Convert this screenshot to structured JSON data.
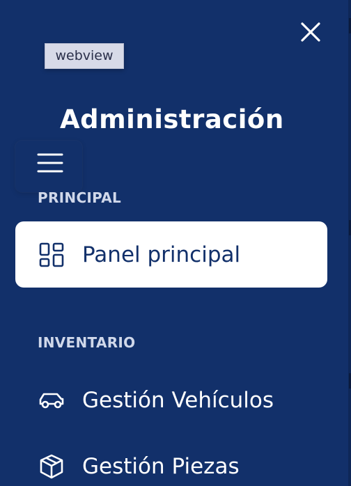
{
  "drawer": {
    "title": "Administración",
    "tooltip": "webview",
    "close_icon": "close-icon",
    "menu_icon": "hamburger-menu-icon"
  },
  "sections": [
    {
      "label": "PRINCIPAL",
      "items": [
        {
          "label": "Panel principal",
          "icon": "dashboard-grid-icon",
          "active": true
        }
      ]
    },
    {
      "label": "INVENTARIO",
      "items": [
        {
          "label": "Gestión Vehículos",
          "icon": "car-icon",
          "active": false
        },
        {
          "label": "Gestión Piezas",
          "icon": "box-icon",
          "active": false
        }
      ]
    }
  ],
  "colors": {
    "background": "#12306a",
    "active_item_bg": "#ffffff",
    "active_text": "#12306a",
    "text": "#ffffff",
    "section_label": "#d0d8ea"
  }
}
